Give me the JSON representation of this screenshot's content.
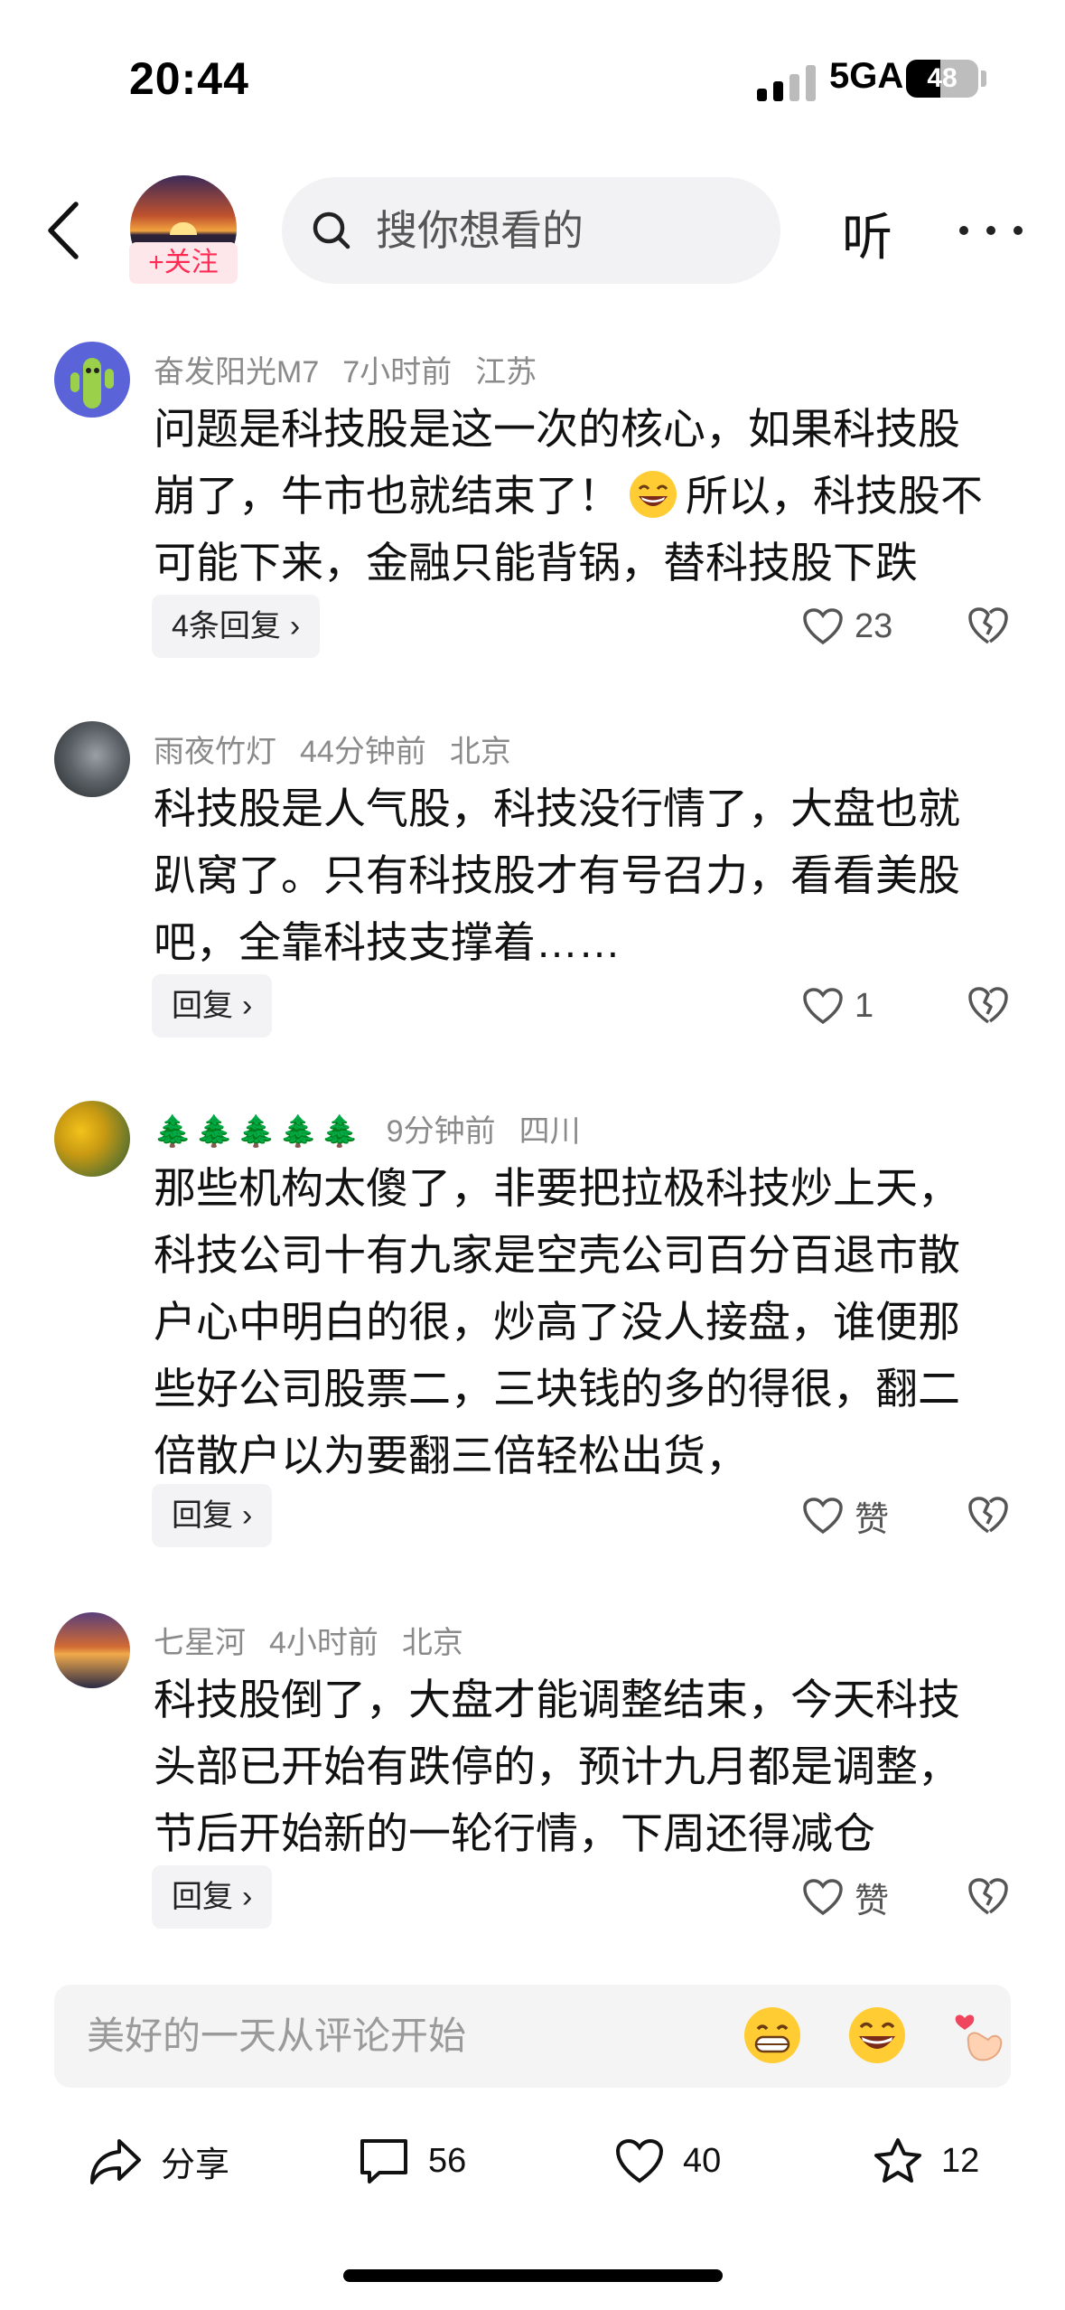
{
  "status_bar": {
    "time": "20:44",
    "network": "5GA",
    "battery": "48",
    "battery_level": 0.48
  },
  "header": {
    "follow_label": "+关注",
    "search_placeholder": "搜你想看的",
    "listen_label": "听"
  },
  "comments": [
    {
      "user": "奋发阳光M7",
      "time": "7小时前",
      "location": "江苏",
      "text_before": "问题是科技股是这一次的核心，如果科技股崩了，牛市也就结束了！",
      "text_after": "所以，科技股不可能下来，金融只能背锅，替科技股下跌",
      "inline_emoji": "grinning-emoji",
      "reply_label": "4条回复",
      "likes": "23"
    },
    {
      "user": "雨夜竹灯",
      "time": "44分钟前",
      "location": "北京",
      "text": "科技股是人气股，科技没行情了，大盘也就趴窝了。只有科技股才有号召力，看看美股吧，全靠科技支撑着……",
      "reply_label": "回复",
      "likes": "1"
    },
    {
      "user": "🌲🌲🌲🌲🌲",
      "time": "9分钟前",
      "location": "四川",
      "text": "那些机构太傻了，非要把拉极科技炒上天，科技公司十有九家是空壳公司百分百退市散户心中明白的很，炒高了没人接盘，谁便那些好公司股票二，三块钱的多的得很，翻二倍散户以为要翻三倍轻松出货，",
      "reply_label": "回复",
      "likes": "赞"
    },
    {
      "user": "七星河",
      "time": "4小时前",
      "location": "北京",
      "text": "科技股倒了，大盘才能调整结束，今天科技头部已开始有跌停的，预计九月都是调整，节后开始新的一轮行情，下周还得减仓",
      "reply_label": "回复",
      "likes": "赞"
    }
  ],
  "comment_bar": {
    "placeholder": "美好的一天从评论开始",
    "emojis": [
      "grin-emoji",
      "laugh-emoji",
      "finger-heart-emoji"
    ]
  },
  "actions": {
    "share": "分享",
    "comments": "56",
    "likes": "40",
    "favorites": "12"
  },
  "colors": {
    "accent": "#fe2c55",
    "muted": "#8a8a8a",
    "bar_bg": "#f4f4f5"
  }
}
